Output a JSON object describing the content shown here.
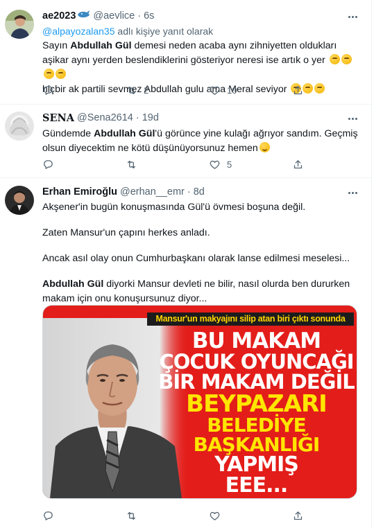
{
  "tweets": [
    {
      "name": "ae2023",
      "handle": "@aevlice",
      "time": "6s",
      "reply_handle": "@alpayozalan35",
      "reply_suffix": "adlı kişiye yanıt olarak",
      "line1_pre": "Sayın ",
      "line1_bold": "Abdullah Gül",
      "line1_post": " demesi neden acaba aynı zihniyetten oldukları aşikar aynı yerden beslendiklerini gösteriyor neresi ise artık o yer",
      "line2": "hiçbir ak partili sevmez Abdullah gulu ama Meral seviyor",
      "replies": "",
      "retweets": "2",
      "likes": "10"
    },
    {
      "name": "SENA",
      "handle": "@Sena2614",
      "time": "19d",
      "line1_pre": "Gündemde ",
      "line1_bold": "Abdullah Gül",
      "line1_post": "'ü görünce yine kulağı ağrıyor sandım. Geçmiş olsun diyecektim ne kötü düşünüyorsunuz hemen",
      "replies": "",
      "retweets": "",
      "likes": "5"
    },
    {
      "name": "Erhan Emiroğlu",
      "handle": "@erhan__emr",
      "time": "8d",
      "p1": "Akşener'in bugün konuşmasında Gül'ü övmesi boşuna değil.",
      "p2": "Zaten Mansur'un çapını herkes anladı.",
      "p3": "Ancak asıl olay onun Cumhurbaşkanı olarak lanse edilmesi meselesi...",
      "p4_bold": "Abdullah Gül",
      "p4_post": " diyorki Mansur devleti ne bilir, nasıl olurda ben dururken makam için onu konuşursunuz diyor...",
      "media": {
        "banner": "Mansur'un makyajını silip atan biri çıktı sonunda",
        "headline": [
          "BU MAKAM",
          "ÇOCUK OYUNCAĞI",
          "BİR MAKAM DEĞİL",
          "BEYPAZARI",
          "BELEDİYE",
          "BAŞKANLIĞI",
          "YAPMIŞ",
          "EEE..."
        ]
      },
      "replies": "",
      "retweets": "",
      "likes": ""
    }
  ],
  "icons": {
    "reply": "speech-bubble-icon",
    "retweet": "retweet-arrows-icon",
    "like": "heart-outline-icon",
    "share": "share-upload-icon",
    "more": "more-dots-icon",
    "verified_like": "whale-emoji-icon"
  },
  "colors": {
    "link": "#1d9bf0",
    "muted": "#536471",
    "text": "#0f1419",
    "media_red": "#e31d1a",
    "headline_yellow": "#ffe600"
  }
}
